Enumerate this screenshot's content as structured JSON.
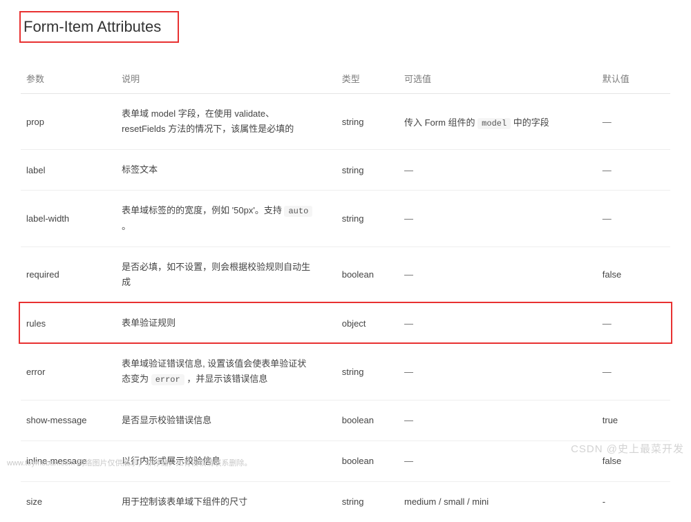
{
  "title": "Form-Item Attributes",
  "headers": {
    "param": "参数",
    "desc": "说明",
    "type": "类型",
    "opts": "可选值",
    "default": "默认值"
  },
  "rows": [
    {
      "param": "prop",
      "desc_pre": "表单域 model 字段，在使用 validate、resetFields 方法的情况下，该属性是必填的",
      "type": "string",
      "opts_pre": "传入 Form 组件的 ",
      "opts_code": "model",
      "opts_post": " 中的字段",
      "default": "—"
    },
    {
      "param": "label",
      "desc_pre": "标签文本",
      "type": "string",
      "opts_plain": "—",
      "default": "—"
    },
    {
      "param": "label-width",
      "desc_pre": "表单域标签的的宽度，例如 '50px'。支持 ",
      "desc_code": "auto",
      "desc_post": "。",
      "type": "string",
      "opts_plain": "—",
      "default": "—"
    },
    {
      "param": "required",
      "desc_pre": "是否必填，如不设置，则会根据校验规则自动生成",
      "type": "boolean",
      "opts_plain": "—",
      "default": "false"
    },
    {
      "param": "rules",
      "desc_pre": "表单验证规则",
      "type": "object",
      "opts_plain": "—",
      "default": "—",
      "highlighted": true
    },
    {
      "param": "error",
      "desc_pre": "表单域验证错误信息, 设置该值会使表单验证状态变为 ",
      "desc_code": "error",
      "desc_post": "，并显示该错误信息",
      "type": "string",
      "opts_plain": "—",
      "default": "—"
    },
    {
      "param": "show-message",
      "desc_pre": "是否显示校验错误信息",
      "type": "boolean",
      "opts_plain": "—",
      "default": "true"
    },
    {
      "param": "inline-message",
      "desc_pre": "以行内形式展示校验信息",
      "type": "boolean",
      "opts_plain": "—",
      "default": "false"
    },
    {
      "param": "size",
      "desc_pre": "用于控制该表单域下组件的尺寸",
      "type": "string",
      "opts_plain": "medium / small / mini",
      "default": "-"
    }
  ],
  "watermark_right": "CSDN @史上最菜开发",
  "watermark_left": "www.toymoban.com 网络图片仅供展示，非存储，如有侵权请联系删除。"
}
